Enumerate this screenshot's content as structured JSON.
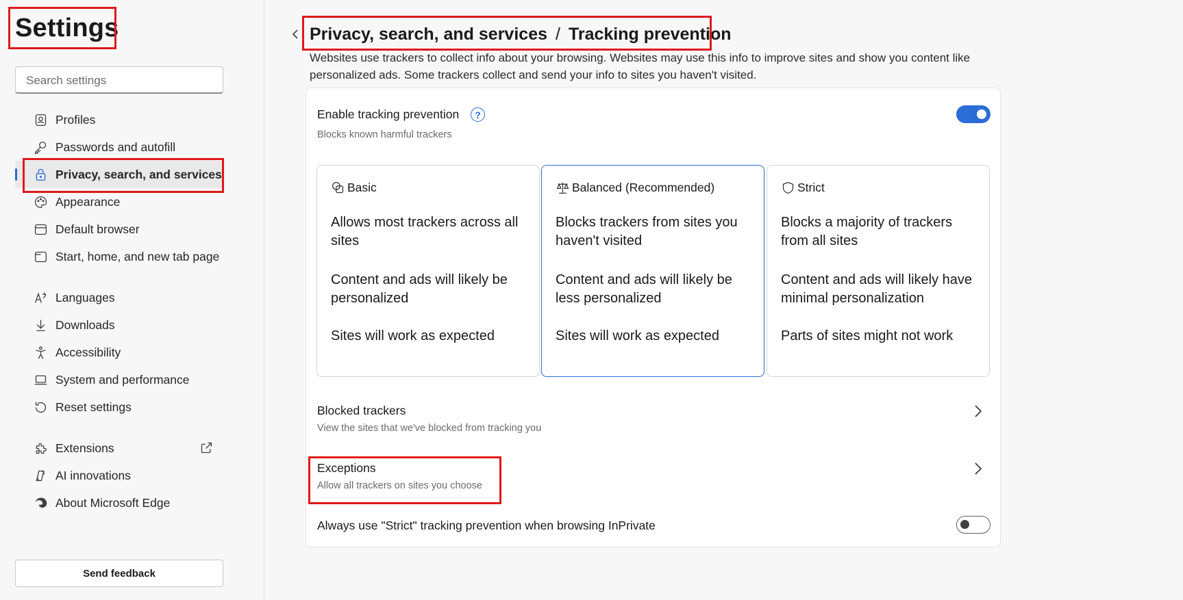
{
  "sidebar": {
    "title": "Settings",
    "search_placeholder": "Search settings",
    "items": [
      {
        "label": "Profiles",
        "icon": "profile-icon"
      },
      {
        "label": "Passwords and autofill",
        "icon": "key-icon"
      },
      {
        "label": "Privacy, search, and services",
        "icon": "lock-icon",
        "active": true
      },
      {
        "label": "Appearance",
        "icon": "palette-icon"
      },
      {
        "label": "Default browser",
        "icon": "browser-icon"
      },
      {
        "label": "Start, home, and new tab page",
        "icon": "tab-page-icon"
      },
      {
        "label": "Languages",
        "icon": "languages-icon"
      },
      {
        "label": "Downloads",
        "icon": "download-icon"
      },
      {
        "label": "Accessibility",
        "icon": "accessibility-icon"
      },
      {
        "label": "System and performance",
        "icon": "laptop-icon"
      },
      {
        "label": "Reset settings",
        "icon": "reset-icon"
      },
      {
        "label": "Extensions",
        "icon": "puzzle-icon"
      },
      {
        "label": "AI innovations",
        "icon": "ai-icon"
      },
      {
        "label": "About Microsoft Edge",
        "icon": "edge-logo-icon"
      }
    ],
    "feedback_label": "Send feedback"
  },
  "header": {
    "breadcrumb_parent": "Privacy, search, and services",
    "breadcrumb_separator": "/",
    "breadcrumb_current": "Tracking prevention",
    "description": "Websites use trackers to collect info about your browsing. Websites may use this info to improve sites and show you content like personalized ads. Some trackers collect and send your info to sites you haven't visited."
  },
  "tracking": {
    "enable_title": "Enable tracking prevention",
    "enable_subtitle": "Blocks known harmful trackers",
    "enable_state": true,
    "levels": [
      {
        "name": "Basic",
        "icon": "basic-shapes-icon",
        "selected": false,
        "lines": [
          "Allows most trackers across all sites",
          "Content and ads will likely be personalized",
          "Sites will work as expected"
        ]
      },
      {
        "name": "Balanced (Recommended)",
        "icon": "scales-icon",
        "selected": true,
        "lines": [
          "Blocks trackers from sites you haven't visited",
          "Content and ads will likely be less personalized",
          "Sites will work as expected"
        ]
      },
      {
        "name": "Strict",
        "icon": "shield-icon",
        "selected": false,
        "lines": [
          "Blocks a majority of trackers from all sites",
          "Content and ads will likely have minimal personalization",
          "Parts of sites might not work"
        ]
      }
    ],
    "blocked_title": "Blocked trackers",
    "blocked_subtitle": "View the sites that we've blocked from tracking you",
    "exceptions_title": "Exceptions",
    "exceptions_subtitle": "Allow all trackers on sites you choose",
    "inprivate_title": "Always use \"Strict\" tracking prevention when browsing InPrivate",
    "inprivate_state": false
  },
  "colors": {
    "accent": "#2b6cd6",
    "highlight": "#e0181b"
  }
}
